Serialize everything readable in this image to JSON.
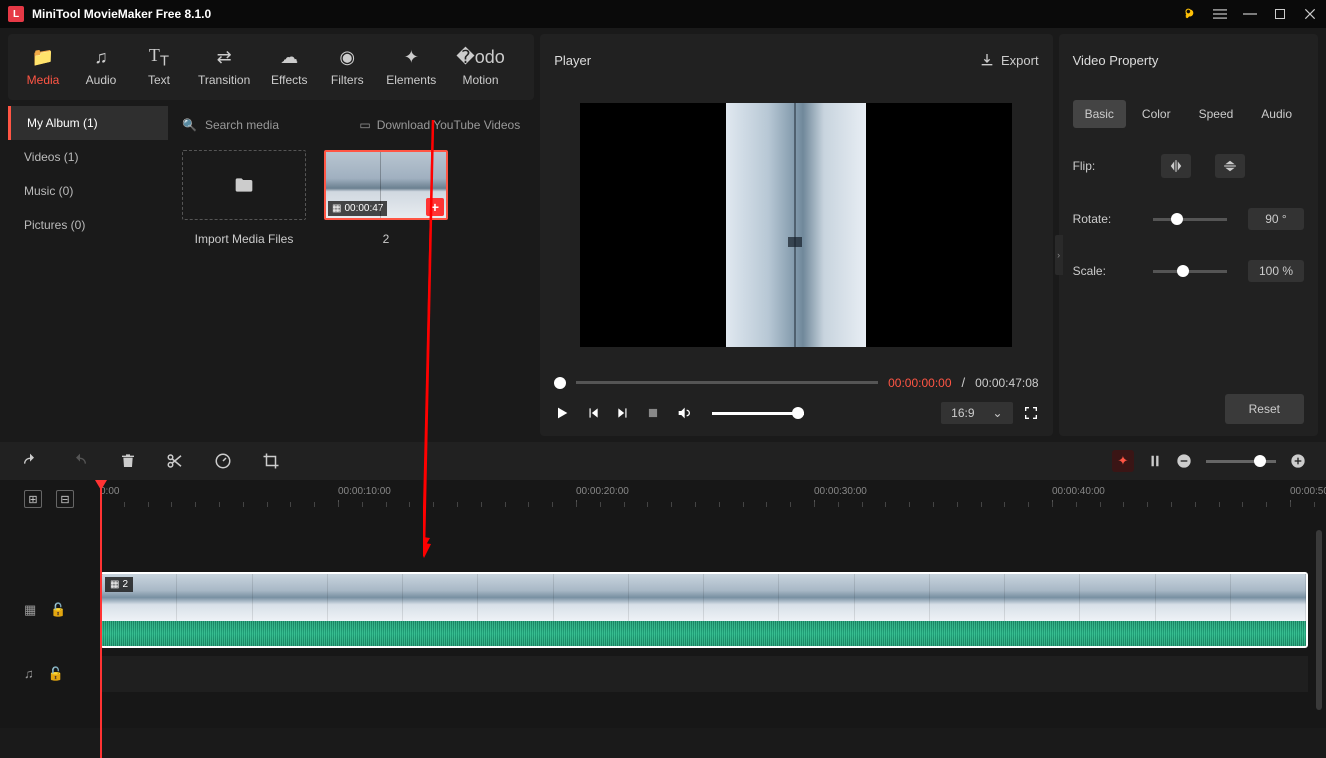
{
  "app": {
    "title": "MiniTool MovieMaker Free 8.1.0"
  },
  "toolbar": {
    "items": [
      {
        "label": "Media"
      },
      {
        "label": "Audio"
      },
      {
        "label": "Text"
      },
      {
        "label": "Transition"
      },
      {
        "label": "Effects"
      },
      {
        "label": "Filters"
      },
      {
        "label": "Elements"
      },
      {
        "label": "Motion"
      }
    ]
  },
  "sidebar": {
    "items": [
      {
        "label": "My Album (1)"
      },
      {
        "label": "Videos (1)"
      },
      {
        "label": "Music (0)"
      },
      {
        "label": "Pictures (0)"
      }
    ]
  },
  "media": {
    "search_placeholder": "Search media",
    "download_label": "Download YouTube Videos",
    "import_label": "Import Media Files",
    "thumb_duration": "00:00:47",
    "thumb_count": "2"
  },
  "player": {
    "title": "Player",
    "export": "Export",
    "current_time": "00:00:00:00",
    "total_time": "00:00:47:08",
    "aspect": "16:9"
  },
  "props": {
    "title": "Video Property",
    "tabs": [
      "Basic",
      "Color",
      "Speed",
      "Audio"
    ],
    "flip_label": "Flip:",
    "rotate_label": "Rotate:",
    "rotate_value": "90 °",
    "scale_label": "Scale:",
    "scale_value": "100 %",
    "reset": "Reset"
  },
  "timeline": {
    "ticks": [
      "0:00",
      "00:00:10:00",
      "00:00:20:00",
      "00:00:30:00",
      "00:00:40:00",
      "00:00:50"
    ],
    "clip_badge": "2"
  }
}
